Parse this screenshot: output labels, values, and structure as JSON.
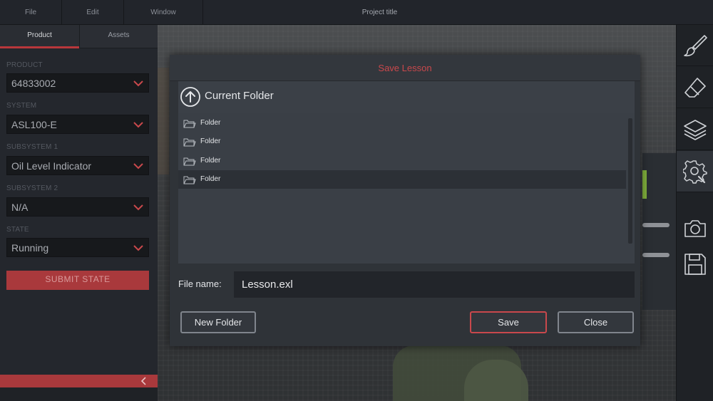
{
  "menubar": {
    "file": "File",
    "edit": "Edit",
    "window": "Window",
    "project_title": "Project title"
  },
  "left_panel": {
    "tabs": [
      "Product",
      "Assets"
    ],
    "fields": [
      {
        "label": "PRODUCT",
        "value": "64833002"
      },
      {
        "label": "SYSTEM",
        "value": "ASL100-E"
      },
      {
        "label": "SUBSYSTEM 1",
        "value": "Oil Level Indicator"
      },
      {
        "label": "SUBSYSTEM 2",
        "value": "N/A"
      },
      {
        "label": "STATE",
        "value": "Running"
      }
    ],
    "submit_label": "SUBMIT STATE"
  },
  "toolbar": {
    "icons": [
      "brush-icon",
      "eraser-icon",
      "layers-icon",
      "settings-icon",
      "camera-icon",
      "save-disk-icon"
    ]
  },
  "dialog": {
    "title": "Save Lesson",
    "current_folder": "Current Folder",
    "items": [
      "Folder",
      "Folder",
      "Folder",
      "Folder"
    ],
    "file_name_label": "File name:",
    "file_name_value": "Lesson.exl",
    "new_folder_label": "New Folder",
    "save_label": "Save",
    "close_label": "Close"
  },
  "colors": {
    "accent": "#c9484c",
    "accent_fill": "#a9393c",
    "panel": "#24272d",
    "dialog": "#2f3338"
  }
}
